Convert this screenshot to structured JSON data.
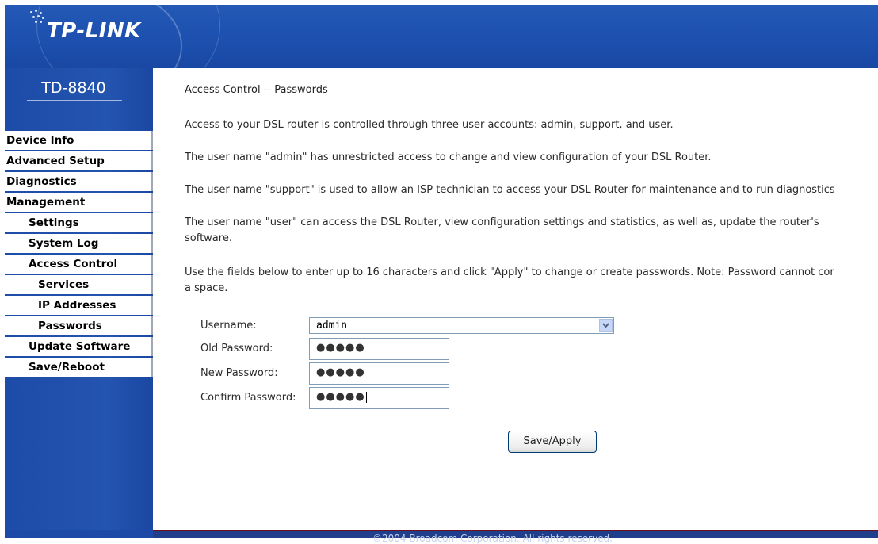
{
  "header": {
    "logo_text": "TP-LINK",
    "model": "TD-8840"
  },
  "menu": [
    {
      "label": "Device Info"
    },
    {
      "label": "Advanced Setup"
    },
    {
      "label": "Diagnostics"
    },
    {
      "label": "Management"
    },
    {
      "label": "Settings"
    },
    {
      "label": "System Log"
    },
    {
      "label": "Access Control"
    },
    {
      "label": "Services"
    },
    {
      "label": "IP Addresses"
    },
    {
      "label": "Passwords"
    },
    {
      "label": "Update Software"
    },
    {
      "label": "Save/Reboot"
    }
  ],
  "content": {
    "title": "Access Control -- Passwords",
    "paragraphs": [
      "Access to your DSL router is controlled through three user accounts: admin, support, and user.",
      "The user name \"admin\" has unrestricted access to change and view configuration of your DSL Router.",
      "The user name \"support\" is used to allow an ISP technician to access your DSL Router for maintenance and to run diagnostics",
      "The user name \"user\" can access the DSL Router, view configuration settings and statistics, as well as, update the router's",
      "software.",
      "Use the fields below to enter up to 16 characters and click \"Apply\" to change or create passwords. Note: Password cannot cor",
      "a space."
    ]
  },
  "form": {
    "username_label": "Username:",
    "username_value": "admin",
    "old_password_label": "Old Password:",
    "old_password_value": "●●●●●",
    "new_password_label": "New Password:",
    "new_password_value": "●●●●●",
    "confirm_password_label": "Confirm Password:",
    "confirm_password_value": "●●●●●",
    "apply_label": "Save/Apply"
  },
  "footer": {
    "text": "©2004 Broadcom Corporation. All rights reserved."
  },
  "colors": {
    "sidebar_blue": "#1c4aa6",
    "header_blue": "#1a4aa8"
  }
}
